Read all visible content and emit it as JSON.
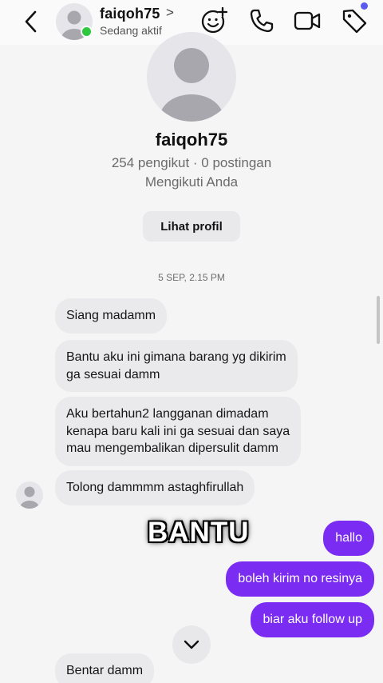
{
  "header": {
    "username": "faiqoh75",
    "chevron": ">",
    "status": "Sedang aktif",
    "icons": [
      "back-icon",
      "effects-icon",
      "phone-icon",
      "video-icon",
      "tag-icon"
    ],
    "online_color": "#2ec83f",
    "notification_color": "#5b5bf0"
  },
  "profile": {
    "name": "faiqoh75",
    "stats": "254 pengikut · 0 postingan",
    "follow_status": "Mengikuti Anda",
    "view_button": "Lihat profil"
  },
  "timestamp": "5 SEP, 2.15 PM",
  "messages": [
    {
      "side": "in",
      "text": "Siang madamm"
    },
    {
      "side": "in",
      "text": "Bantu aku ini gimana barang yg dikirim\nga sesuai damm"
    },
    {
      "side": "in",
      "text": "Aku bertahun2 langganan dimadam\nkenapa baru kali ini ga sesuai dan saya\nmau mengembalikan dipersulit damm"
    },
    {
      "side": "in",
      "text": "Tolong dammmm astaghfirullah"
    },
    {
      "side": "out",
      "text": "hallo"
    },
    {
      "side": "out",
      "text": "boleh kirim no resinya"
    },
    {
      "side": "out",
      "text": "biar aku follow up"
    },
    {
      "side": "in",
      "text": "Bentar damm"
    }
  ],
  "overlay_caption": "BANTU",
  "colors": {
    "outgoing_bubble": "#7a2cf2",
    "incoming_bubble": "#eaeaec",
    "background": "#f5f5f6"
  }
}
